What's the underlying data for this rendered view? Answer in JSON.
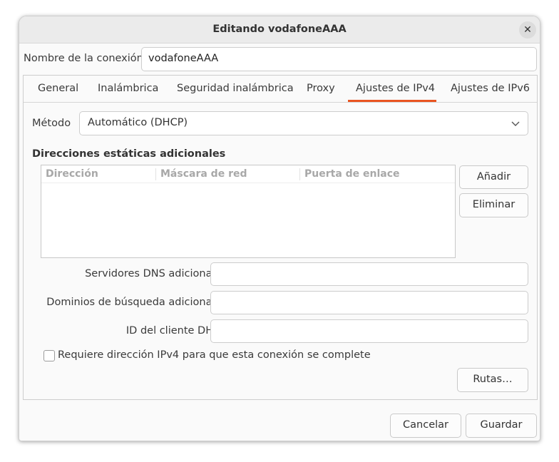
{
  "window": {
    "title": "Editando vodafoneAAA",
    "close_glyph": "✕"
  },
  "connection_name": {
    "label": "Nombre de la conexión",
    "value": "vodafoneAAA"
  },
  "tabs": [
    {
      "label": "General"
    },
    {
      "label": "Inalámbrica"
    },
    {
      "label": "Seguridad inalámbrica"
    },
    {
      "label": "Proxy"
    },
    {
      "label": "Ajustes de IPv4",
      "active": true
    },
    {
      "label": "Ajustes de IPv6"
    }
  ],
  "method": {
    "label": "Método",
    "value": "Automático (DHCP)"
  },
  "static_addresses": {
    "title": "Direcciones estáticas adicionales",
    "columns": [
      "Dirección",
      "Máscara de red",
      "Puerta de enlace"
    ],
    "rows": [],
    "add_label": "Añadir",
    "remove_label": "Eliminar"
  },
  "dns": {
    "label": "Servidores DNS adicionales",
    "value": ""
  },
  "search_domains": {
    "label": "Dominios de búsqueda adicionales",
    "value": ""
  },
  "dhcp_client_id": {
    "label": "ID del cliente DHCP",
    "value": ""
  },
  "require_ipv4": {
    "label": "Requiere dirección IPv4 para que esta conexión se complete",
    "checked": false
  },
  "routes_label": "Rutas…",
  "footer": {
    "cancel_label": "Cancelar",
    "save_label": "Guardar"
  },
  "colors": {
    "accent": "#e95420"
  }
}
